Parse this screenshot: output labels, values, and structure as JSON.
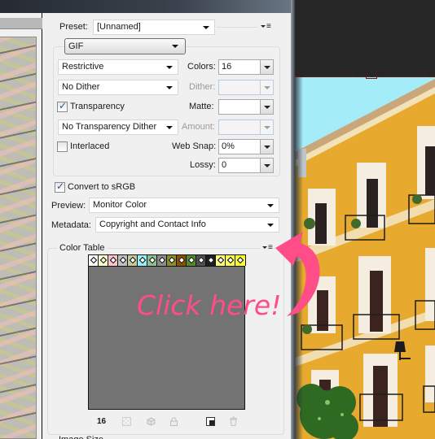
{
  "panel": {
    "preset": {
      "label": "Preset:",
      "value": "[Unnamed]"
    },
    "format": "GIF",
    "reduction": "Restrictive",
    "colors": {
      "label": "Colors:",
      "value": "16"
    },
    "dither_algo": "No Dither",
    "dither": {
      "label": "Dither:",
      "value": ""
    },
    "transparency": {
      "label": "Transparency",
      "checked": true
    },
    "matte": {
      "label": "Matte:",
      "value": ""
    },
    "transparency_dither": "No Transparency Dither",
    "amount": {
      "label": "Amount:",
      "value": ""
    },
    "interlaced": {
      "label": "Interlaced",
      "checked": false
    },
    "web_snap": {
      "label": "Web Snap:",
      "value": "0%"
    },
    "lossy": {
      "label": "Lossy:",
      "value": "0"
    },
    "convert_srgb": {
      "label": "Convert to sRGB",
      "checked": true
    },
    "preview": {
      "label": "Preview:",
      "value": "Monitor Color"
    },
    "metadata": {
      "label": "Metadata:",
      "value": "Copyright and Contact Info"
    },
    "color_table": {
      "title": "Color Table",
      "count": "16",
      "swatches": [
        "#ffffff",
        "#ffffc8",
        "#ffc0c8",
        "#c0c0c0",
        "#c8c896",
        "#8ef0f8",
        "#8cc08c",
        "#8c8c8c",
        "#8c8c28",
        "#8c5000",
        "#508c28",
        "#505050",
        "#1e1e1e",
        "#ffff78",
        "#ffff50",
        "#ffff28"
      ]
    },
    "image_size_label": "Image Size"
  },
  "annotation": {
    "text": "Click here!",
    "color": "#ff4d88"
  }
}
